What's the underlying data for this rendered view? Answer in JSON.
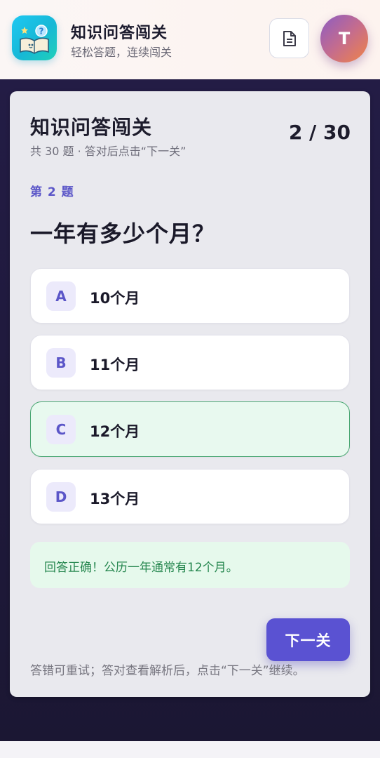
{
  "header": {
    "app_title": "知识问答闯关",
    "app_subtitle": "轻松答题，连续闯关",
    "logo_icon": "book-question-icon",
    "doc_icon": "document-icon",
    "avatar_initial": "T"
  },
  "card": {
    "title": "知识问答闯关",
    "meta": "共 30 题 · 答对后点击“下一关”",
    "progress": "2 / 30",
    "question_number": "第 2 题",
    "question_text": "一年有多少个月？",
    "options": [
      {
        "letter": "A",
        "label": "10个月"
      },
      {
        "letter": "B",
        "label": "11个月"
      },
      {
        "letter": "C",
        "label": "12个月"
      },
      {
        "letter": "D",
        "label": "13个月"
      }
    ],
    "feedback": "回答正确！公历一年通常有12个月。",
    "next_label": "下一关",
    "footer_hint": "答错可重试；答对查看解析后，点击“下一关”继续。"
  },
  "colors": {
    "accent": "#5a52d2",
    "correct_bg": "#e8f9ef",
    "correct_border": "#4aa773",
    "correct_text": "#25864e"
  }
}
